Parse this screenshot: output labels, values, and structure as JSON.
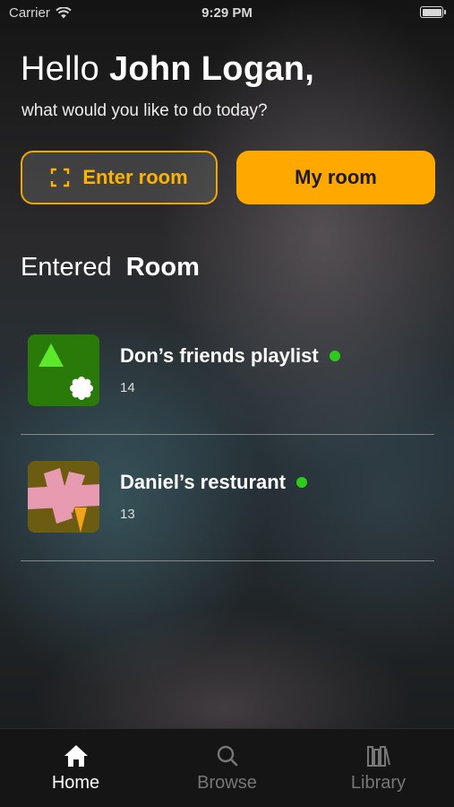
{
  "status_bar": {
    "carrier": "Carrier",
    "time": "9:29 PM"
  },
  "header": {
    "greeting": "Hello",
    "user_name": "John Logan,",
    "subtitle": "what would you like to do today?"
  },
  "actions": {
    "enter_room_label": "Enter room",
    "enter_room_icon": "scan-frame-icon",
    "my_room_label": "My room"
  },
  "section": {
    "title_light": "Entered",
    "title_bold": "Room"
  },
  "rooms": [
    {
      "name": "Don’s friends playlist",
      "count": "14",
      "live": true,
      "thumb_colors": [
        "#2a7a0a",
        "#5ee82a",
        "#ffffff"
      ]
    },
    {
      "name": "Daniel’s resturant",
      "count": "13",
      "live": true,
      "thumb_colors": [
        "#6b5c12",
        "#e79ab0",
        "#f2a31c"
      ]
    }
  ],
  "tab_bar": {
    "tabs": [
      {
        "label": "Home",
        "icon": "home-icon",
        "active": true
      },
      {
        "label": "Browse",
        "icon": "search-icon",
        "active": false
      },
      {
        "label": "Library",
        "icon": "library-icon",
        "active": false
      }
    ]
  },
  "colors": {
    "accent": "#ffa800",
    "live": "#2ecc1a",
    "tab_bar_bg": "#151515"
  }
}
